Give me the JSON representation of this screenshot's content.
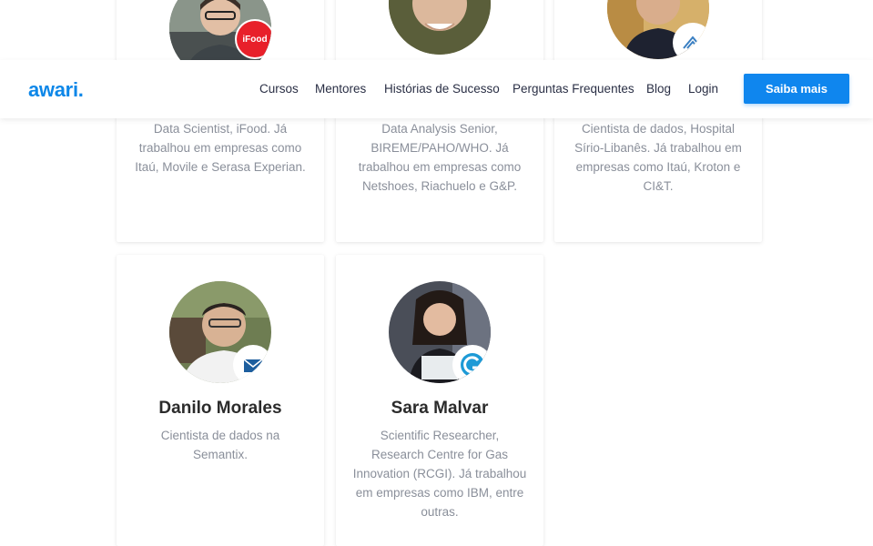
{
  "header": {
    "logo_text": "awari",
    "logo_dot": ".",
    "nav": [
      "Cursos",
      "Mentores",
      "Histórias de Sucesso",
      "Perguntas Frequentes",
      "Blog",
      "Login"
    ],
    "cta_label": "Saiba mais"
  },
  "mentors_top": [
    {
      "description": "Data Scientist, iFood. Já trabalhou em empresas como Itaú, Movile e Serasa Experian.",
      "badge": "iFood"
    },
    {
      "description": "Data Analysis Senior, BIREME/PAHO/WHO. Já trabalhou em empresas como Netshoes, Riachuelo e G&P."
    },
    {
      "description": "Cientista de dados, Hospital Sírio-Libanês. Já trabalhou em empresas como Itaú, Kroton e CI&T."
    }
  ],
  "mentors_bottom": [
    {
      "name": "Danilo Morales",
      "description": "Cientista de dados na Semantix."
    },
    {
      "name": "Sara Malvar",
      "description": "Scientific Researcher, Research Centre for Gas Innovation (RCGI). Já trabalhou em empresas como IBM, entre outras."
    }
  ],
  "colors": {
    "accent": "#0f86ee",
    "text_dark": "#2a2f45",
    "text_muted": "#8a8f9a"
  }
}
